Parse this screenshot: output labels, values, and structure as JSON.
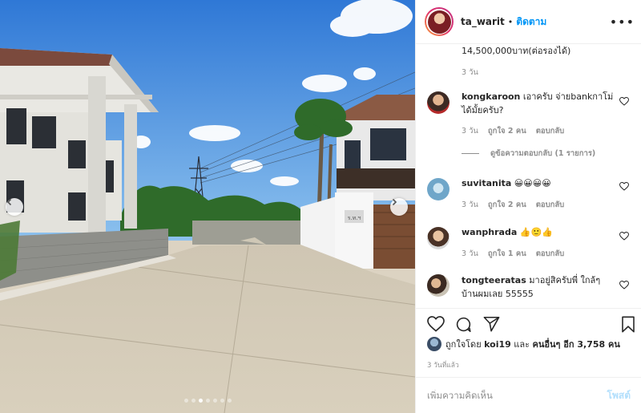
{
  "post": {
    "owner": "ta_warit",
    "separator": "•",
    "follow_label": "ติดตาม",
    "more_label": "•••",
    "likes_prefix": "ถูกใจโดย",
    "liker": "koi19",
    "likes_mid": "และ",
    "likes_others": "คนอื่นๆ อีก 3,758 คน",
    "time": "3 วันที่แล้ว"
  },
  "previous_comment": {
    "text": "14,500,000บาท(ต่อรองได้)",
    "time": "3 วัน"
  },
  "comments": [
    {
      "user": "kongkaroon",
      "text": "เอาครับ จ่ายbankกาโม่ได้มั้ยครับ?",
      "time": "3 วัน",
      "likes": "ถูกใจ 2 คน",
      "reply": "ตอบกลับ",
      "view_replies": "ดูข้อความตอบกลับ (1 รายการ)"
    },
    {
      "user": "suvitanita",
      "text": "😀😀😀😀",
      "time": "3 วัน",
      "likes": "ถูกใจ 2 คน",
      "reply": "ตอบกลับ"
    },
    {
      "user": "wanphrada",
      "text": "👍🙂👍",
      "time": "3 วัน",
      "likes": "ถูกใจ 1 คน",
      "reply": "ตอบกลับ"
    },
    {
      "user": "tongteeratas",
      "text": "มาอยู่สิครับพี่ ใกล้ๆบ้านผมเลย 55555"
    }
  ],
  "input": {
    "placeholder": "เพิ่มความคิดเห็น",
    "post_label": "โพสต์"
  },
  "carousel": {
    "dots": 7,
    "active": 2
  },
  "photo": {
    "gate_sign": "ร.ท.ฯ"
  },
  "icons": {
    "prev": "chevron-left-icon",
    "next": "chevron-right-icon",
    "like": "heart-icon",
    "comment": "comment-icon",
    "share": "send-icon",
    "save": "bookmark-icon"
  },
  "colors": {
    "link": "#0095f6",
    "muted": "#8e8e8e",
    "text": "#262626",
    "post_disabled": "#b2dffc"
  }
}
